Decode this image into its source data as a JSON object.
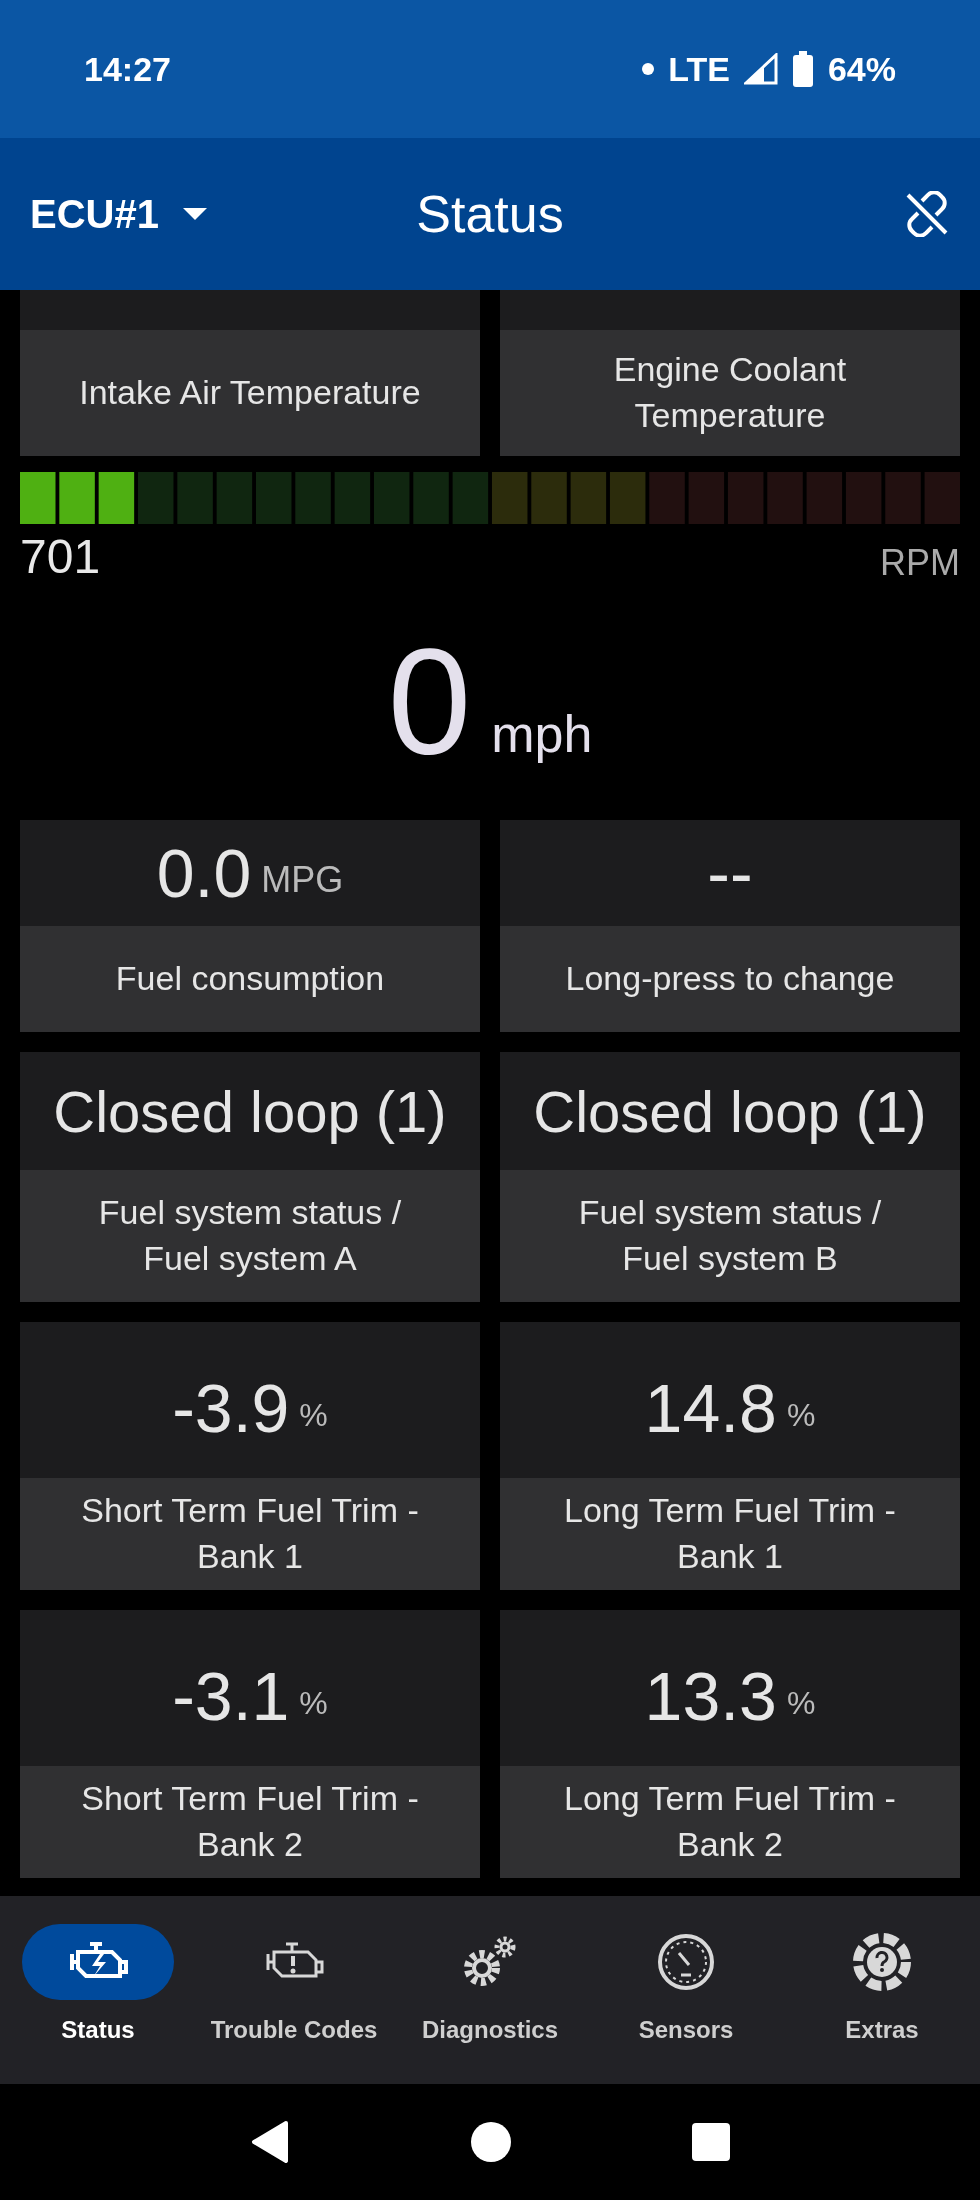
{
  "status_bar": {
    "time": "14:27",
    "network": "LTE",
    "battery": "64%"
  },
  "app_bar": {
    "ecu": "ECU#1",
    "title": "Status"
  },
  "top_cards": [
    {
      "label": "Intake Air Temperature"
    },
    {
      "label": "Engine Coolant Temperature"
    }
  ],
  "rpm": {
    "reading": "701",
    "unit": "RPM"
  },
  "speed": {
    "value": "0",
    "unit": "mph"
  },
  "cards": [
    {
      "value": "0.0",
      "unit": "MPG",
      "label": "Fuel consumption"
    },
    {
      "value": "--",
      "label": "Long-press to change"
    },
    {
      "value": "Closed loop (1)",
      "label": "Fuel system status / Fuel system A"
    },
    {
      "value": "Closed loop (1)",
      "label": "Fuel system status / Fuel system B"
    },
    {
      "value": "-3.9",
      "unit": "%",
      "label": "Short Term Fuel Trim - Bank 1"
    },
    {
      "value": "14.8",
      "unit": "%",
      "label": "Long Term Fuel Trim - Bank 1"
    },
    {
      "value": "-3.1",
      "unit": "%",
      "label": "Short Term Fuel Trim - Bank 2"
    },
    {
      "value": "13.3",
      "unit": "%",
      "label": "Long Term Fuel Trim - Bank 2"
    }
  ],
  "nav": [
    {
      "label": "Status",
      "kind": "status",
      "selected": true
    },
    {
      "label": "Trouble Codes",
      "kind": "codes",
      "selected": false
    },
    {
      "label": "Diagnostics",
      "kind": "diagnostics",
      "selected": false
    },
    {
      "label": "Sensors",
      "kind": "sensors",
      "selected": false
    },
    {
      "label": "Extras",
      "kind": "extras",
      "selected": false
    }
  ]
}
